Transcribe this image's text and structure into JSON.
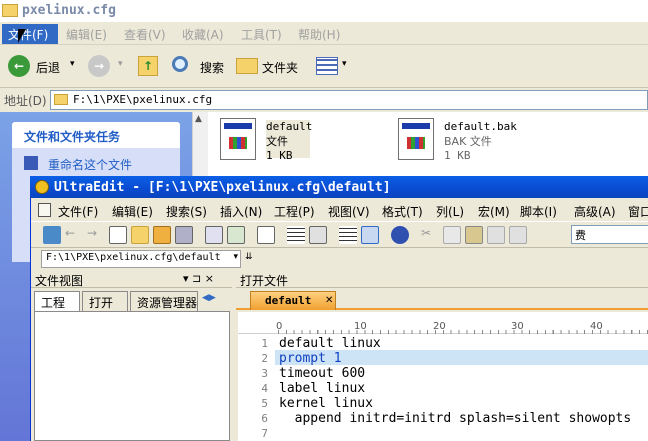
{
  "explorer": {
    "title": "pxelinux.cfg",
    "menu": [
      "文件(F)",
      "编辑(E)",
      "查看(V)",
      "收藏(A)",
      "工具(T)",
      "帮助(H)"
    ],
    "toolbar": {
      "back": "后退",
      "search": "搜索",
      "folders": "文件夹"
    },
    "address_label": "地址(D)",
    "address_value": "F:\\1\\PXE\\pxelinux.cfg",
    "task_header": "文件和文件夹任务",
    "task_item": "重命名这个文件",
    "files": [
      {
        "name": "default",
        "type": "文件",
        "size": "1 KB"
      },
      {
        "name": "default.bak",
        "type": "BAK 文件",
        "size": "1 KB"
      }
    ]
  },
  "ultraedit": {
    "title": "UltraEdit - [F:\\1\\PXE\\pxelinux.cfg\\default]",
    "menu": [
      "文件(F)",
      "编辑(E)",
      "搜索(S)",
      "插入(N)",
      "工程(P)",
      "视图(V)",
      "格式(T)",
      "列(L)",
      "宏(M)",
      "脚本(I)",
      "高级(A)",
      "窗口"
    ],
    "combo_value": "费",
    "path_value": "F:\\1\\PXE\\pxelinux.cfg\\default",
    "file_view_title": "文件视图",
    "file_view_pin": "▾ ⊐ ×",
    "file_view_tabs": [
      "工程",
      "打开",
      "资源管理器"
    ],
    "open_files_title": "打开文件",
    "doc_tab": "default",
    "ruler_marks": [
      "0",
      "10",
      "20",
      "30",
      "40"
    ],
    "lines": [
      {
        "n": "1",
        "text": "default linux"
      },
      {
        "n": "2",
        "text": "prompt 1"
      },
      {
        "n": "3",
        "text": "timeout 600"
      },
      {
        "n": "4",
        "text": "label linux"
      },
      {
        "n": "5",
        "text": "kernel linux"
      },
      {
        "n": "6",
        "text": "  append initrd=initrd splash=silent showopts"
      },
      {
        "n": "7",
        "text": ""
      }
    ]
  },
  "colors": {
    "xp_blue": "#0a4bd0",
    "highlight_line": "#cde4f7",
    "tab_orange": "#f0a030"
  }
}
